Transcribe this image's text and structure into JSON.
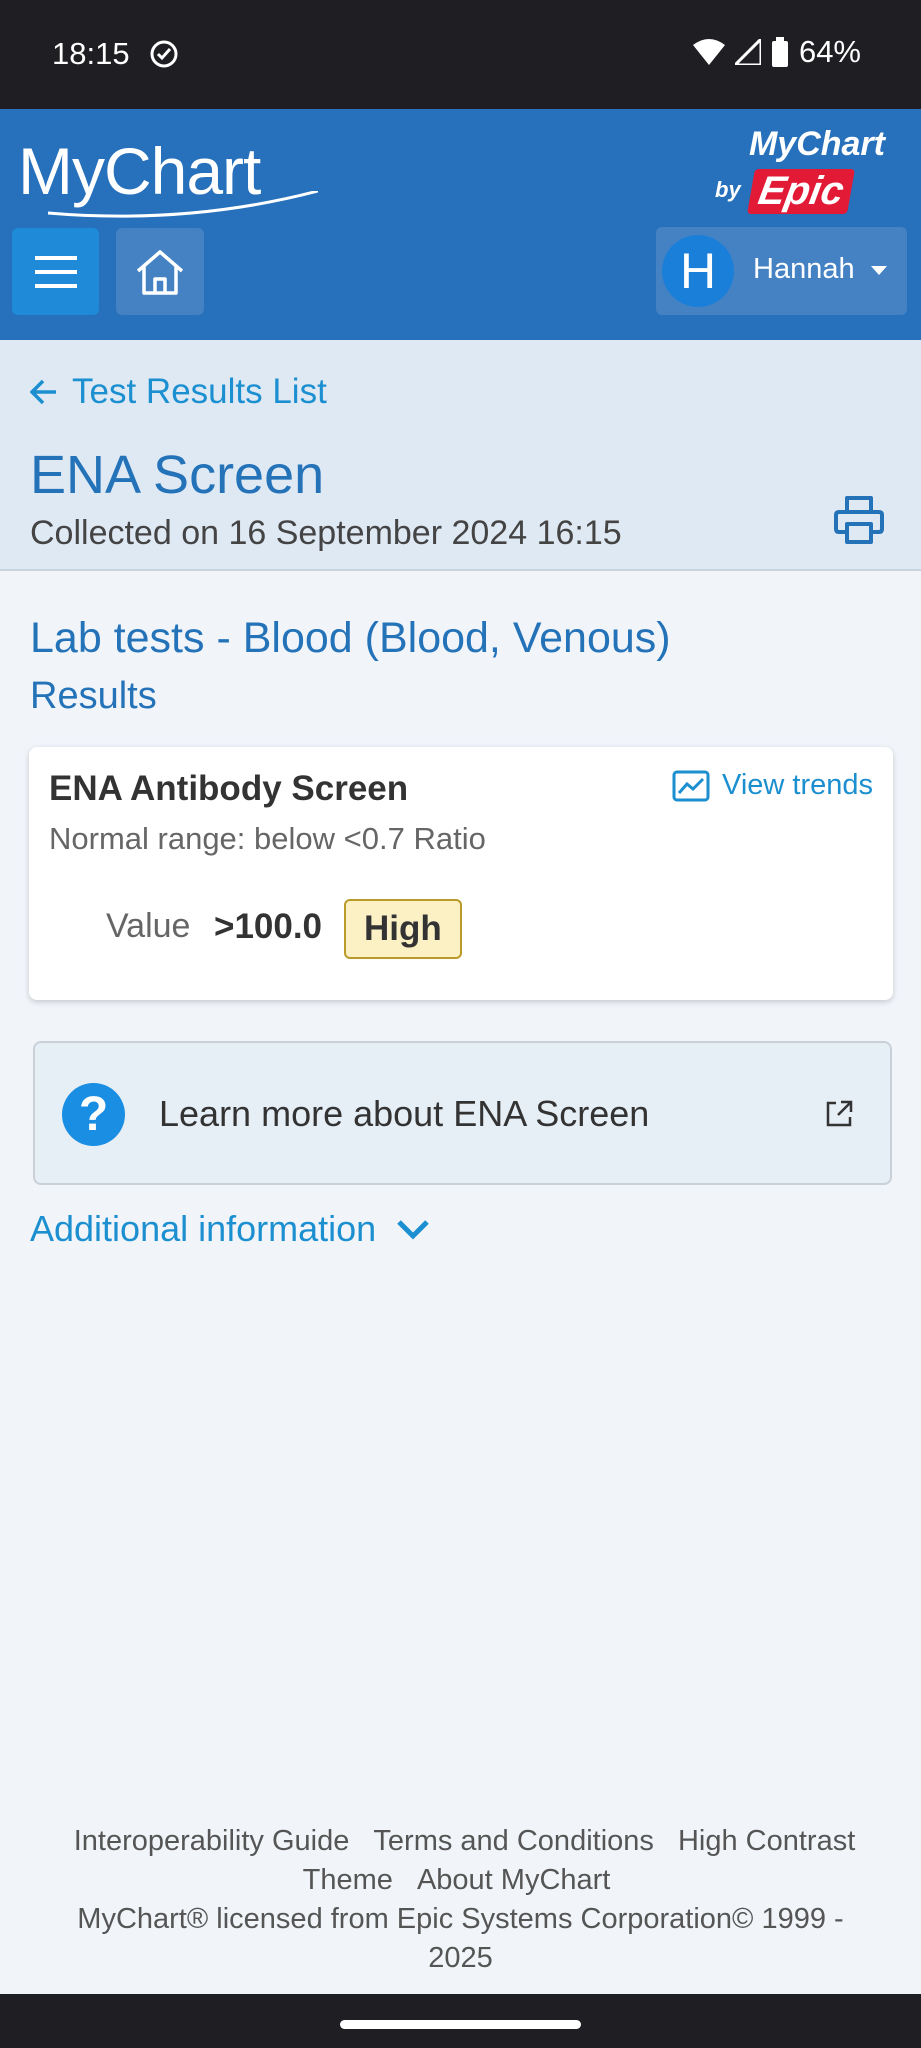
{
  "status_bar": {
    "time": "18:15",
    "battery": "64%"
  },
  "header": {
    "logo": "MyChart",
    "brand_top": "MyChart",
    "brand_by": "by",
    "brand_epic": "Epic",
    "user_initial": "H",
    "user_name": "Hannah"
  },
  "nav": {
    "back_label": "Test Results List"
  },
  "page": {
    "title": "ENA Screen",
    "collected": "Collected on 16 September 2024 16:15"
  },
  "section": {
    "title": "Lab tests - Blood (Blood, Venous)",
    "subtitle": "Results"
  },
  "result": {
    "name": "ENA Antibody Screen",
    "view_trends": "View trends",
    "range": "Normal range: below <0.7 Ratio",
    "value_label": "Value",
    "value": ">100.0",
    "flag": "High"
  },
  "learn_more": {
    "text": "Learn more about ENA Screen"
  },
  "additional": {
    "label": "Additional information"
  },
  "footer": {
    "links": [
      "Interoperability Guide",
      "Terms and Conditions",
      "High Contrast Theme",
      "About MyChart"
    ],
    "license": "MyChart® licensed from Epic Systems Corporation© 1999 - 2025"
  }
}
